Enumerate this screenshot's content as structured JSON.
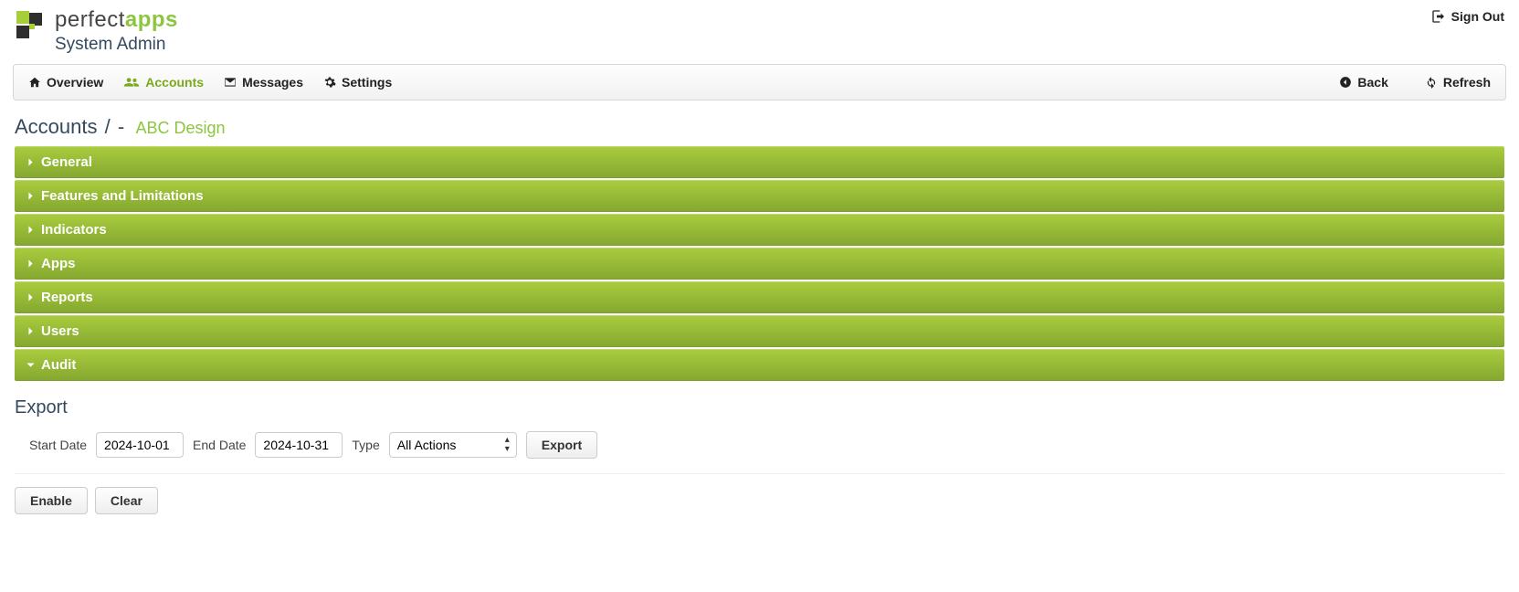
{
  "header": {
    "brand_perfect": "perfect",
    "brand_apps": "apps",
    "subtitle": "System Admin",
    "signout_label": "Sign Out"
  },
  "nav": {
    "overview": "Overview",
    "accounts": "Accounts",
    "messages": "Messages",
    "settings": "Settings",
    "back": "Back",
    "refresh": "Refresh"
  },
  "breadcrumb": {
    "root": "Accounts",
    "sep1": "/",
    "dash": "-",
    "current": "ABC Design"
  },
  "accordion": {
    "general": "General",
    "features": "Features and Limitations",
    "indicators": "Indicators",
    "apps": "Apps",
    "reports": "Reports",
    "users": "Users",
    "audit": "Audit"
  },
  "export": {
    "title": "Export",
    "start_date_label": "Start Date",
    "start_date_value": "2024-10-01",
    "end_date_label": "End Date",
    "end_date_value": "2024-10-31",
    "type_label": "Type",
    "type_value": "All Actions",
    "export_button": "Export"
  },
  "footer": {
    "enable": "Enable",
    "clear": "Clear"
  }
}
